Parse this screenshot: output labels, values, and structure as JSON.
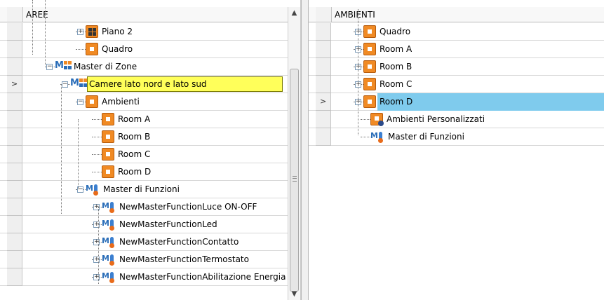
{
  "left_panel": {
    "header": "AREE",
    "rows": [
      {
        "label": "Piano 2",
        "icon": "grid-icon",
        "expander": "+",
        "current": false
      },
      {
        "label": "Quadro",
        "icon": "room-icon",
        "expander": "",
        "current": false
      },
      {
        "label": "Master di Zone",
        "icon": "master-zone-icon",
        "expander": "−",
        "current": false
      },
      {
        "label": "Camere lato nord e lato sud",
        "icon": "master-zone-icon",
        "expander": "−",
        "current": true
      },
      {
        "label": "Ambienti",
        "icon": "room-icon",
        "expander": "−",
        "current": false
      },
      {
        "label": "Room A",
        "icon": "room-icon",
        "expander": "",
        "current": false
      },
      {
        "label": "Room B",
        "icon": "room-icon",
        "expander": "",
        "current": false
      },
      {
        "label": "Room C",
        "icon": "room-icon",
        "expander": "",
        "current": false
      },
      {
        "label": "Room D",
        "icon": "room-icon",
        "expander": "",
        "current": false
      },
      {
        "label": "Master di Funzioni",
        "icon": "master-function-icon",
        "expander": "−",
        "current": false
      },
      {
        "label": "NewMasterFunctionLuce ON-OFF",
        "icon": "master-function-icon",
        "expander": "+",
        "current": false
      },
      {
        "label": "NewMasterFunctionLed",
        "icon": "master-function-icon",
        "expander": "+",
        "current": false
      },
      {
        "label": "NewMasterFunctionContatto",
        "icon": "master-function-icon",
        "expander": "+",
        "current": false
      },
      {
        "label": "NewMasterFunctionTermostato",
        "icon": "master-function-icon",
        "expander": "+",
        "current": false
      },
      {
        "label": "NewMasterFunctionAbilitazione Energia",
        "icon": "master-function-icon",
        "expander": "+",
        "current": false
      }
    ],
    "current_row_indicator": ">"
  },
  "right_panel": {
    "header": "AMBIENTI",
    "rows": [
      {
        "label": "Quadro",
        "icon": "room-icon",
        "expander": "+",
        "current": false
      },
      {
        "label": "Room A",
        "icon": "room-icon",
        "expander": "+",
        "current": false
      },
      {
        "label": "Room B",
        "icon": "room-icon",
        "expander": "+",
        "current": false
      },
      {
        "label": "Room C",
        "icon": "room-icon",
        "expander": "+",
        "current": false
      },
      {
        "label": "Room D",
        "icon": "room-icon",
        "expander": "+",
        "current": true
      },
      {
        "label": "Ambienti Personalizzati",
        "icon": "custom-rooms-icon",
        "expander": "",
        "current": false
      },
      {
        "label": "Master di Funzioni",
        "icon": "master-function-icon",
        "expander": "",
        "current": false
      }
    ],
    "current_row_indicator": ">"
  },
  "scrollbar": {
    "up_icon": "▲",
    "down_icon": "▼"
  },
  "colors": {
    "highlight_yellow": "#ffff5a",
    "highlight_blue": "#7fcbed",
    "room_orange": "#f08a24"
  }
}
